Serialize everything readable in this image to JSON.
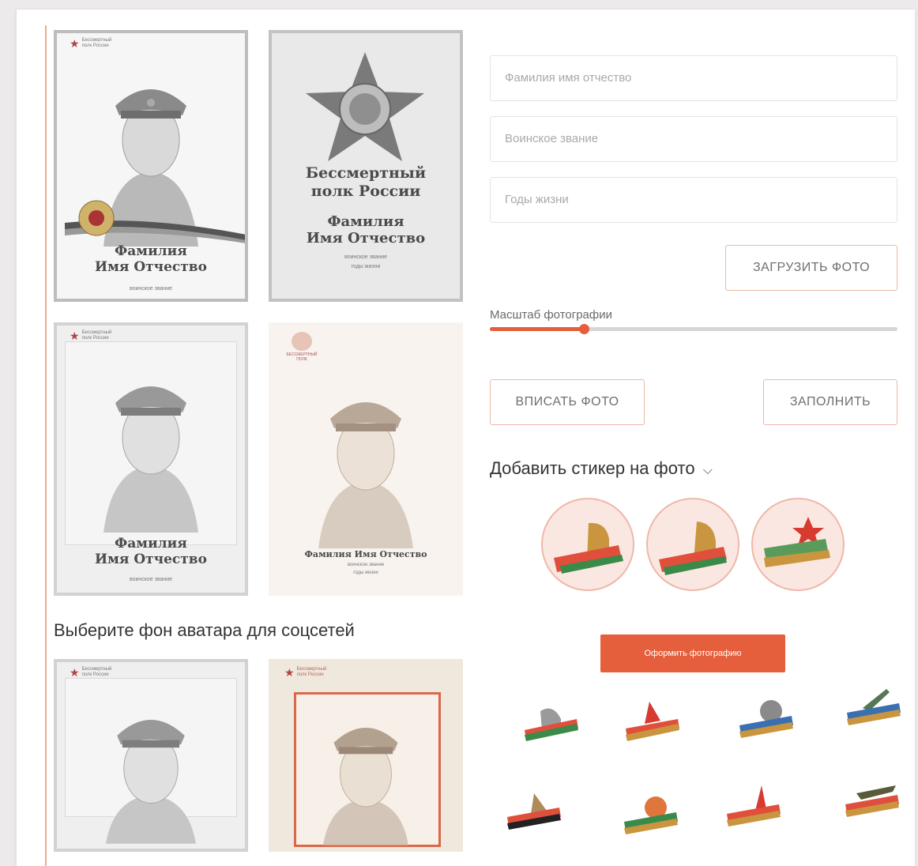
{
  "form": {
    "full_name_placeholder": "Фамилия имя отчество",
    "rank_placeholder": "Воинское звание",
    "years_placeholder": "Годы жизни",
    "upload_label": "ЗАГРУЗИТЬ ФОТО",
    "scale_label": "Масштаб фотографии",
    "scale_value": 0.23,
    "fit_label": "ВПИСАТЬ ФОТО",
    "fill_label": "ЗАПОЛНИТЬ",
    "sticker_title": "Добавить стикер на фото",
    "sticker_chevron": "⌵",
    "apply_label": "Оформить фотографию"
  },
  "templates": [
    {
      "brand_line1": "Бессмертный",
      "brand_line2": "полк России",
      "name_line1": "Фамилия",
      "name_line2": "Имя Отчество",
      "sub": "воинское звание"
    },
    {
      "title_line1": "Бессмертный",
      "title_line2": "полк России",
      "name_line1": "Фамилия",
      "name_line2": "Имя Отчество",
      "sub1": "воинское звание",
      "sub2": "годы жизни"
    },
    {
      "brand_line1": "Бессмертный",
      "brand_line2": "полк России",
      "name_line1": "Фамилия",
      "name_line2": "Имя Отчество",
      "sub": "воинское звание"
    },
    {
      "brand": "БЕССМЕРТНЫЙ ПОЛК",
      "name": "Фамилия Имя Отчество",
      "sub1": "воинское звание",
      "sub2": "годы жизни"
    }
  ],
  "avatar_section": {
    "title": "Выберите фон аватара для соцсетей",
    "cards": [
      {
        "brand_line1": "Бессмертный",
        "brand_line2": "полк России"
      },
      {
        "brand_line1": "Бессмертный",
        "brand_line2": "полк России"
      }
    ]
  },
  "colors": {
    "accent": "#e65f3c",
    "border_accent": "#ebb9a4"
  }
}
